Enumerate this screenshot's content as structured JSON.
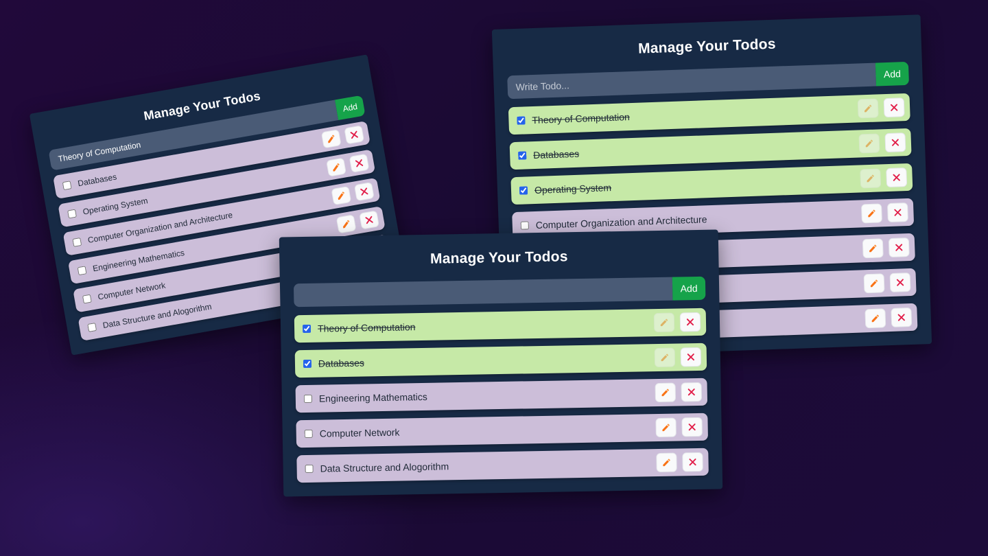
{
  "panels": {
    "left": {
      "title": "Manage Your Todos",
      "input_value": "Theory of Computation",
      "input_placeholder": "Write Todo...",
      "add_label": "Add",
      "todos": [
        {
          "text": "Databases",
          "done": false
        },
        {
          "text": "Operating System",
          "done": false
        },
        {
          "text": "Computer Organization and Architecture",
          "done": false
        },
        {
          "text": "Engineering Mathematics",
          "done": false
        },
        {
          "text": "Computer Network",
          "done": false
        },
        {
          "text": "Data Structure and Alogorithm",
          "done": false
        }
      ]
    },
    "right": {
      "title": "Manage Your Todos",
      "input_value": "",
      "input_placeholder": "Write Todo...",
      "add_label": "Add",
      "todos": [
        {
          "text": "Theory of Computation",
          "done": true
        },
        {
          "text": "Databases",
          "done": true
        },
        {
          "text": "Operating System",
          "done": true
        },
        {
          "text": "Computer Organization and Architecture",
          "done": false
        },
        {
          "text": "",
          "done": false
        },
        {
          "text": "",
          "done": false
        },
        {
          "text": "",
          "done": false
        }
      ]
    },
    "center": {
      "title": "Manage Your Todos",
      "input_value": "",
      "input_placeholder": "",
      "add_label": "Add",
      "todos": [
        {
          "text": "Theory of Computation",
          "done": true
        },
        {
          "text": "Databases",
          "done": true
        },
        {
          "text": "Engineering Mathematics",
          "done": false
        },
        {
          "text": "Computer Network",
          "done": false
        },
        {
          "text": "Data Structure and Alogorithm",
          "done": false
        }
      ]
    }
  },
  "icons": {
    "edit": "pencil-icon",
    "delete": "close-icon"
  },
  "colors": {
    "panel_bg": "#172a45",
    "pending_bg": "#ccbed9",
    "done_bg": "#c6e9a7",
    "add_green": "#16a34a",
    "delete_red": "#e11d48",
    "pencil_orange": "#f97316"
  }
}
